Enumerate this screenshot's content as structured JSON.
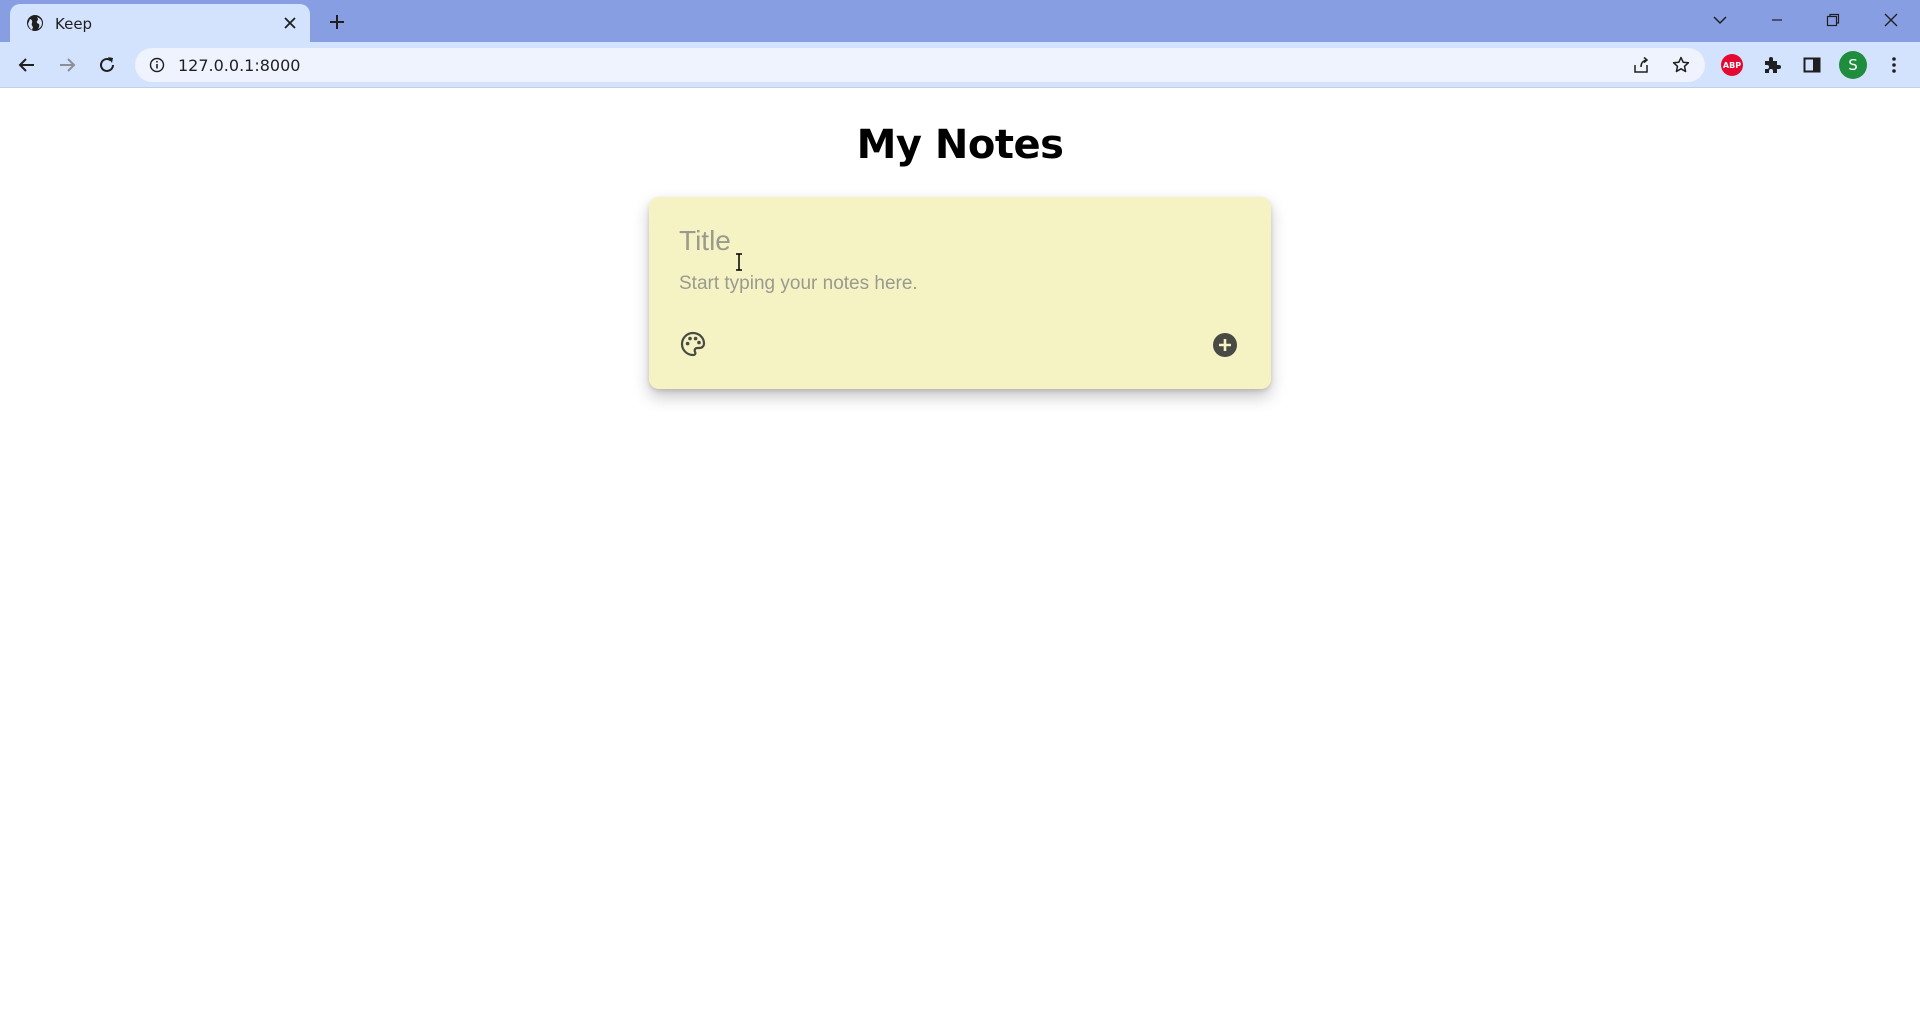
{
  "browser": {
    "tab": {
      "title": "Keep",
      "favicon": "globe-icon"
    },
    "address": {
      "url": "127.0.0.1:8000"
    },
    "extensions": {
      "abp_label": "ABP",
      "profile_initial": "S"
    }
  },
  "app": {
    "heading": "My Notes",
    "note_form": {
      "title_placeholder": "Title",
      "body_placeholder": "Start typing your notes here.",
      "background_color": "#f5f3c4",
      "palette_icon": "palette-icon",
      "add_icon": "add-circle-icon"
    }
  }
}
